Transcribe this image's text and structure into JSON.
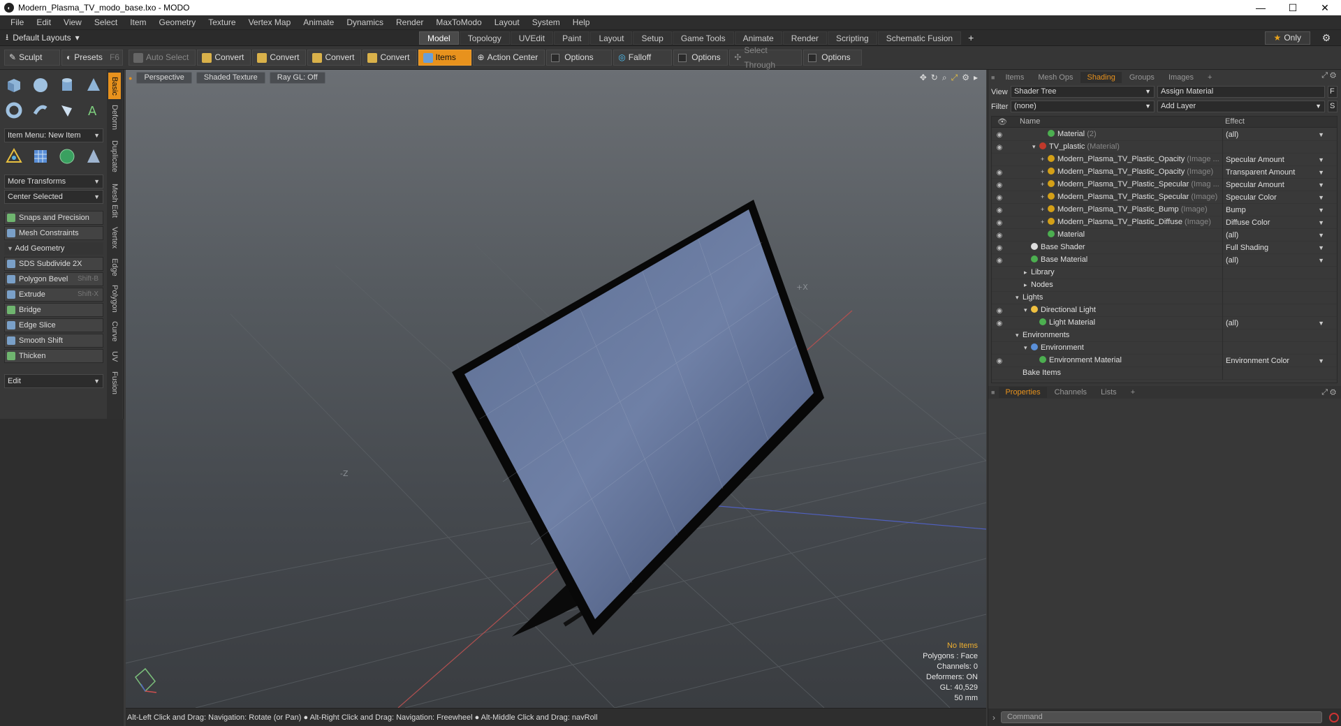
{
  "window": {
    "title": "Modern_Plasma_TV_modo_base.lxo - MODO",
    "app_icon": "modo-logo",
    "controls": [
      "—",
      "☐",
      "✕"
    ]
  },
  "menu": [
    "File",
    "Edit",
    "View",
    "Select",
    "Item",
    "Geometry",
    "Texture",
    "Vertex Map",
    "Animate",
    "Dynamics",
    "Render",
    "MaxToModo",
    "Layout",
    "System",
    "Help"
  ],
  "layout_tabs": {
    "default_layouts": "Default Layouts",
    "tabs": [
      "Model",
      "Topology",
      "UVEdit",
      "Paint",
      "Layout",
      "Setup",
      "Game Tools",
      "Animate",
      "Render",
      "Scripting",
      "Schematic Fusion"
    ],
    "active": "Model",
    "plus": "+",
    "only_label": "Only",
    "accent": "#e8921d"
  },
  "toolbar": {
    "sculpt": "Sculpt",
    "presets": "Presets",
    "presets_shortcut": "F6",
    "auto_select": "Auto Select",
    "convert": "Convert",
    "items": "Items",
    "action_center": "Action Center",
    "options": "Options",
    "falloff": "Falloff",
    "select_through": "Select Through"
  },
  "left_panel": {
    "vertical_tabs": [
      "Basic",
      "Deform",
      "Duplicate",
      "Mesh Edit",
      "Vertex",
      "Edge",
      "Polygon",
      "Curve",
      "UV",
      "Fusion"
    ],
    "active_tab": "Basic",
    "item_menu": "Item Menu: New Item",
    "more_transforms": "More Transforms",
    "center_selected": "Center Selected",
    "snaps": "Snaps and Precision",
    "mesh_constraints": "Mesh Constraints",
    "add_geometry": "Add Geometry",
    "tools": [
      {
        "label": "SDS Subdivide 2X",
        "shortcut": ""
      },
      {
        "label": "Polygon Bevel",
        "shortcut": "Shift-B"
      },
      {
        "label": "Extrude",
        "shortcut": "Shift-X"
      },
      {
        "label": "Bridge",
        "shortcut": ""
      },
      {
        "label": "Edge Slice",
        "shortcut": ""
      },
      {
        "label": "Smooth Shift",
        "shortcut": ""
      },
      {
        "label": "Thicken",
        "shortcut": ""
      }
    ],
    "edit": "Edit"
  },
  "viewport": {
    "buttons": [
      "Perspective",
      "Shaded Texture",
      "Ray GL: Off"
    ],
    "info": {
      "no_items": "No Items",
      "polygons": "Polygons : Face",
      "channels": "Channels: 0",
      "deformers": "Deformers: ON",
      "gl": "GL: 40,529",
      "focal": "50 mm"
    },
    "axis_labels": [
      "+X",
      "-Z"
    ]
  },
  "status": "Alt-Left Click and Drag: Navigation: Rotate (or Pan) ● Alt-Right Click and Drag: Navigation: Freewheel ● Alt-Middle Click and Drag: navRoll",
  "right_panel": {
    "tabs": [
      "Items",
      "Mesh Ops",
      "Shading",
      "Groups",
      "Images"
    ],
    "active_tab": "Shading",
    "view_label": "View",
    "view_value": "Shader Tree",
    "assign_material": "Assign Material",
    "f_btn": "F",
    "filter_label": "Filter",
    "filter_value": "(none)",
    "add_layer": "Add Layer",
    "s_btn": "S",
    "col_name": "Name",
    "col_effect": "Effect",
    "rows": [
      {
        "name": "Material",
        "sub": "(2)",
        "effect": "(all)",
        "eye": true,
        "indent": 3,
        "icon": "#4caf50",
        "exp": ""
      },
      {
        "name": "TV_plastic",
        "sub": "(Material)",
        "effect": "",
        "eye": true,
        "indent": 2,
        "icon": "#c0392b",
        "exp": "▾"
      },
      {
        "name": "Modern_Plasma_TV_Plastic_Opacity",
        "sub": "(Image ...",
        "effect": "Specular Amount",
        "eye": false,
        "indent": 3,
        "icon": "#d4a017",
        "exp": "+"
      },
      {
        "name": "Modern_Plasma_TV_Plastic_Opacity",
        "sub": "(Image)",
        "effect": "Transparent Amount",
        "eye": true,
        "indent": 3,
        "icon": "#d4a017",
        "exp": "+"
      },
      {
        "name": "Modern_Plasma_TV_Plastic_Specular",
        "sub": "(Imag ...",
        "effect": "Specular Amount",
        "eye": true,
        "indent": 3,
        "icon": "#d4a017",
        "exp": "+"
      },
      {
        "name": "Modern_Plasma_TV_Plastic_Specular",
        "sub": "(Image)",
        "effect": "Specular Color",
        "eye": true,
        "indent": 3,
        "icon": "#d4a017",
        "exp": "+"
      },
      {
        "name": "Modern_Plasma_TV_Plastic_Bump",
        "sub": "(Image)",
        "effect": "Bump",
        "eye": true,
        "indent": 3,
        "icon": "#d4a017",
        "exp": "+"
      },
      {
        "name": "Modern_Plasma_TV_Plastic_Diffuse",
        "sub": "(Image)",
        "effect": "Diffuse Color",
        "eye": true,
        "indent": 3,
        "icon": "#d4a017",
        "exp": "+"
      },
      {
        "name": "Material",
        "sub": "",
        "effect": "(all)",
        "eye": true,
        "indent": 3,
        "icon": "#4caf50",
        "exp": ""
      },
      {
        "name": "Base Shader",
        "sub": "",
        "effect": "Full Shading",
        "eye": true,
        "indent": 1,
        "icon": "#dddddd",
        "exp": ""
      },
      {
        "name": "Base Material",
        "sub": "",
        "effect": "(all)",
        "eye": true,
        "indent": 1,
        "icon": "#4caf50",
        "exp": ""
      },
      {
        "name": "Library",
        "sub": "",
        "effect": "",
        "eye": false,
        "indent": 1,
        "icon": "",
        "exp": "▸"
      },
      {
        "name": "Nodes",
        "sub": "",
        "effect": "",
        "eye": false,
        "indent": 1,
        "icon": "",
        "exp": "▸"
      },
      {
        "name": "Lights",
        "sub": "",
        "effect": "",
        "eye": false,
        "indent": 0,
        "icon": "",
        "exp": "▾"
      },
      {
        "name": "Directional Light",
        "sub": "",
        "effect": "",
        "eye": true,
        "indent": 1,
        "icon": "#f0c040",
        "exp": "▾"
      },
      {
        "name": "Light Material",
        "sub": "",
        "effect": "(all)",
        "eye": true,
        "indent": 2,
        "icon": "#4caf50",
        "exp": ""
      },
      {
        "name": "Environments",
        "sub": "",
        "effect": "",
        "eye": false,
        "indent": 0,
        "icon": "",
        "exp": "▾"
      },
      {
        "name": "Environment",
        "sub": "",
        "effect": "",
        "eye": false,
        "indent": 1,
        "icon": "#5a8fd8",
        "exp": "▾"
      },
      {
        "name": "Environment Material",
        "sub": "",
        "effect": "Environment Color",
        "eye": true,
        "indent": 2,
        "icon": "#4caf50",
        "exp": ""
      },
      {
        "name": "Bake Items",
        "sub": "",
        "effect": "",
        "eye": false,
        "indent": 0,
        "icon": "",
        "exp": ""
      }
    ],
    "prop_tabs": [
      "Properties",
      "Channels",
      "Lists"
    ],
    "prop_active": "Properties",
    "command_placeholder": "Command"
  }
}
